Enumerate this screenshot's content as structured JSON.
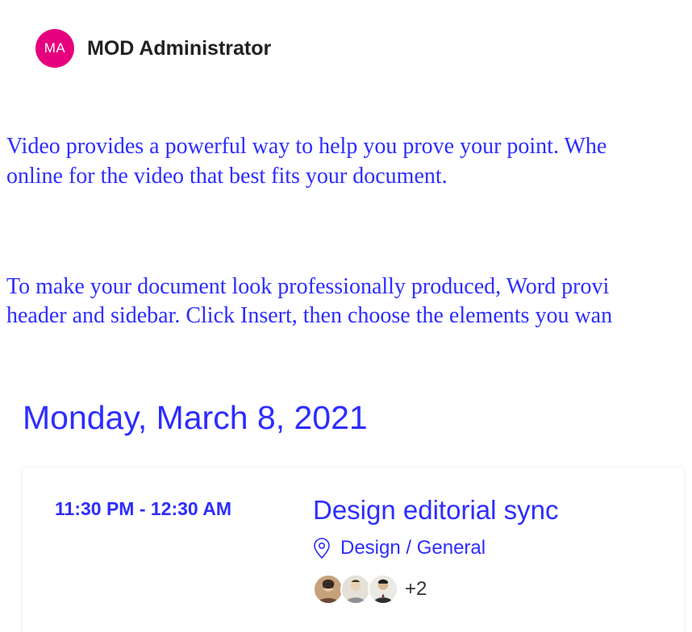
{
  "header": {
    "avatar_initials": "MA",
    "name": "MOD Administrator"
  },
  "body": {
    "paragraph1": "Video provides a powerful way to help you prove your point. Whe\nonline for the video that best fits your document.",
    "paragraph2": "To make your document look professionally produced, Word provi\nheader and sidebar. Click Insert, then choose the elements you wan"
  },
  "agenda": {
    "date": "Monday, March 8, 2021",
    "event": {
      "time": "11:30 PM - 12:30 AM",
      "title": "Design editorial sync",
      "location": "Design / General",
      "attendee_overflow": "+2"
    }
  },
  "icons": {
    "location": "location-pin-icon"
  }
}
